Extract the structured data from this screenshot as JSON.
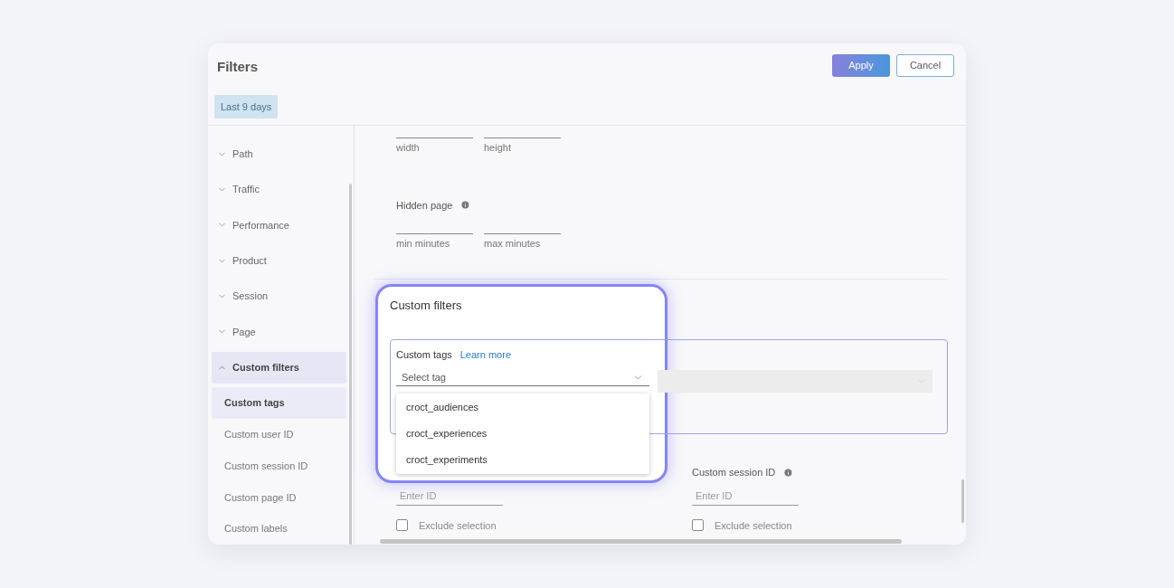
{
  "dialog": {
    "title": "Filters",
    "buttons": [
      {
        "label": "Apply",
        "kind": "primary"
      },
      {
        "label": "Cancel",
        "kind": "secondary"
      }
    ],
    "date_chip": "Last 9 days"
  },
  "sidebar": {
    "sections": [
      {
        "label": "Path",
        "expanded": false,
        "selected": false
      },
      {
        "label": "Traffic",
        "expanded": false,
        "selected": false
      },
      {
        "label": "Performance",
        "expanded": false,
        "selected": false
      },
      {
        "label": "Product",
        "expanded": false,
        "selected": false
      },
      {
        "label": "Session",
        "expanded": false,
        "selected": false
      },
      {
        "label": "Page",
        "expanded": false,
        "selected": false
      },
      {
        "label": "Custom filters",
        "expanded": true,
        "selected": true,
        "children": [
          {
            "label": "Custom tags",
            "selected": true
          },
          {
            "label": "Custom user ID",
            "selected": false
          },
          {
            "label": "Custom session ID",
            "selected": false
          },
          {
            "label": "Custom page ID",
            "selected": false
          },
          {
            "label": "Custom labels",
            "selected": false
          }
        ]
      }
    ]
  },
  "main": {
    "size_fields": [
      {
        "label": "width"
      },
      {
        "label": "height"
      }
    ],
    "hidden_page": {
      "label": "Hidden page",
      "fields": [
        {
          "label": "min minutes"
        },
        {
          "label": "max minutes"
        }
      ]
    },
    "custom_filters": {
      "heading": "Custom filters",
      "tags_label": "Custom tags",
      "link": "Learn more",
      "tag_select": {
        "placeholder": "Select tag",
        "expanded": true,
        "options": [
          "croct_audiences",
          "croct_experiences",
          "croct_experiments"
        ]
      },
      "value_select": {
        "disabled": true
      }
    },
    "id_fields": [
      {
        "placeholder": "Enter ID",
        "exclude": {
          "label": "Exclude selection",
          "checked": false
        }
      },
      {
        "label": "Custom session ID",
        "placeholder": "Enter ID",
        "exclude": {
          "label": "Exclude selection",
          "checked": false
        }
      }
    ]
  }
}
